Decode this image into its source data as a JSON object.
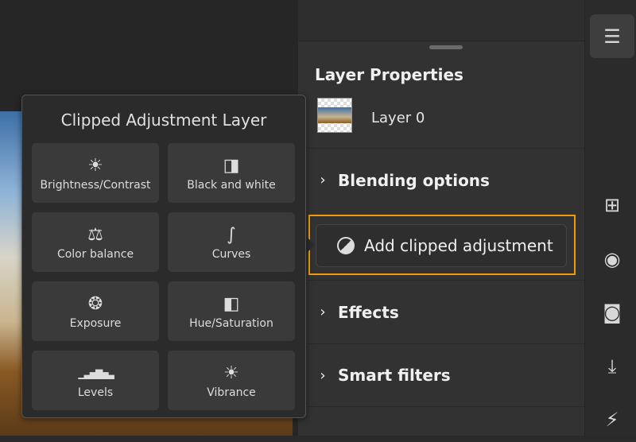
{
  "panel": {
    "title": "Layer Properties",
    "layer_name": "Layer 0",
    "sections": [
      "Blending options",
      "Effects",
      "Smart filters"
    ],
    "add_clipped": "Add clipped adjustment",
    "highlight_color": "#f29a0e"
  },
  "popover": {
    "title": "Clipped Adjustment Layer",
    "items": [
      {
        "label": "Brightness/Contrast",
        "icon": "brightness-icon",
        "glyph": "☀"
      },
      {
        "label": "Black and white",
        "icon": "black-white-icon",
        "glyph": "◨"
      },
      {
        "label": "Color balance",
        "icon": "scale-icon",
        "glyph": "⚖"
      },
      {
        "label": "Curves",
        "icon": "curves-icon",
        "glyph": "∫"
      },
      {
        "label": "Exposure",
        "icon": "aperture-icon",
        "glyph": "❂"
      },
      {
        "label": "Hue/Saturation",
        "icon": "hue-saturation-icon",
        "glyph": "◧"
      },
      {
        "label": "Levels",
        "icon": "levels-icon",
        "glyph": "▁▃▅▇▅▃"
      },
      {
        "label": "Vibrance",
        "icon": "vibrance-icon",
        "glyph": "☀"
      }
    ]
  },
  "toolbar": [
    "adjustments-icon",
    "add-layer-icon",
    "visibility-icon",
    "mask-icon",
    "merge-down-icon",
    "effects-icon"
  ]
}
